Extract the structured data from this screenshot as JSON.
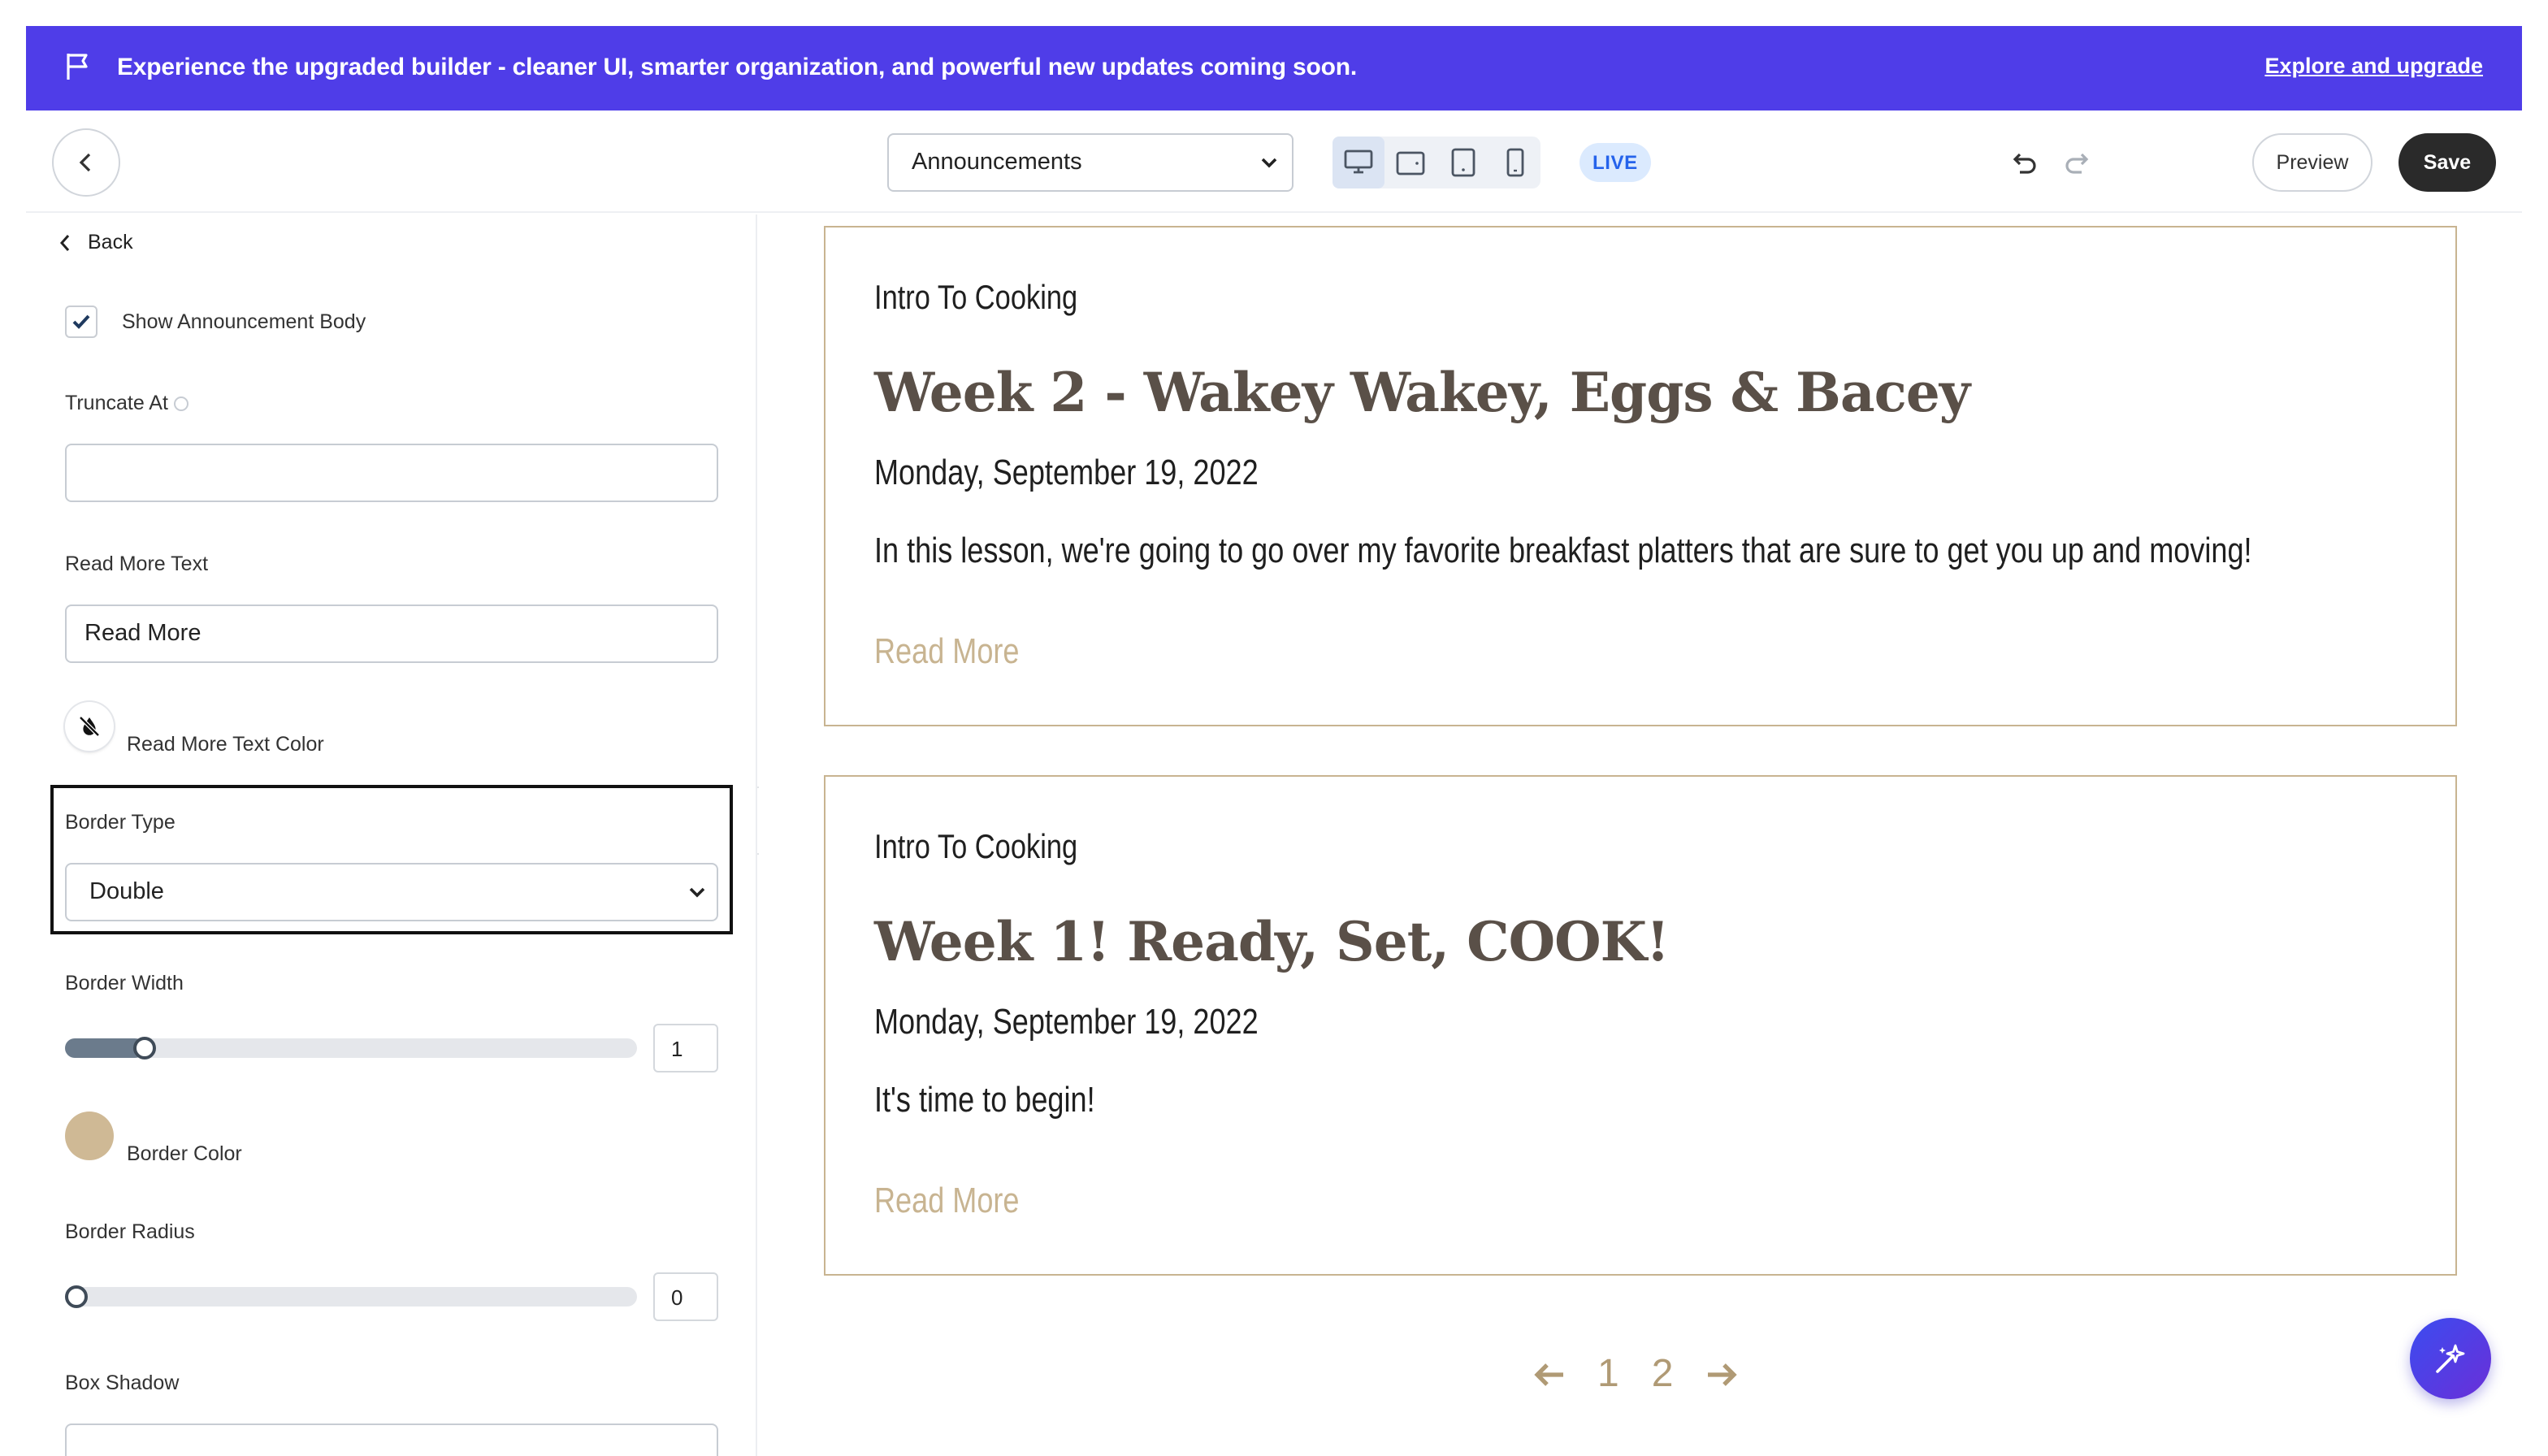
{
  "banner": {
    "icon": "flag-icon",
    "message": "Experience the upgraded builder - cleaner UI, smarter organization, and powerful new updates coming soon.",
    "link": "Explore and upgrade",
    "color": "#4f3de8"
  },
  "topbar": {
    "page_select": "Announcements",
    "devices": [
      "desktop-icon",
      "tablet-landscape-icon",
      "tablet-portrait-icon",
      "mobile-icon"
    ],
    "active_device": "desktop",
    "status": "LIVE",
    "preview_label": "Preview",
    "save_label": "Save"
  },
  "panel": {
    "back_label": "Back",
    "show_body": {
      "label": "Show Announcement Body",
      "checked": true
    },
    "truncate": {
      "label": "Truncate At",
      "value": ""
    },
    "read_more_text": {
      "label": "Read More Text",
      "value": "Read More"
    },
    "read_more_color": {
      "label": "Read More Text Color"
    },
    "border_type": {
      "label": "Border Type",
      "value": "Double"
    },
    "border_width": {
      "label": "Border Width",
      "value": "1",
      "level": 0.12
    },
    "border_color": {
      "label": "Border Color",
      "color": "#cfb995"
    },
    "border_radius": {
      "label": "Border Radius",
      "value": "0",
      "level": 0
    },
    "box_shadow": {
      "label": "Box Shadow"
    }
  },
  "announcements": [
    {
      "course": "Intro To Cooking",
      "title": "Week 2 - Wakey Wakey, Eggs & Bacey",
      "date": "Monday, September 19, 2022",
      "body": "In this lesson, we're going to go over my favorite breakfast platters that are sure to get you up and moving!",
      "read_more": "Read More"
    },
    {
      "course": "Intro To Cooking",
      "title": "Week 1! Ready, Set, COOK!",
      "date": "Monday, September 19, 2022",
      "body": "It's time to begin!",
      "read_more": "Read More"
    }
  ],
  "pagination": {
    "pages": [
      "1",
      "2"
    ]
  },
  "colors": {
    "accent_border": "#c8b491",
    "title": "#5a5048",
    "save_bg": "#2a2a2a"
  }
}
